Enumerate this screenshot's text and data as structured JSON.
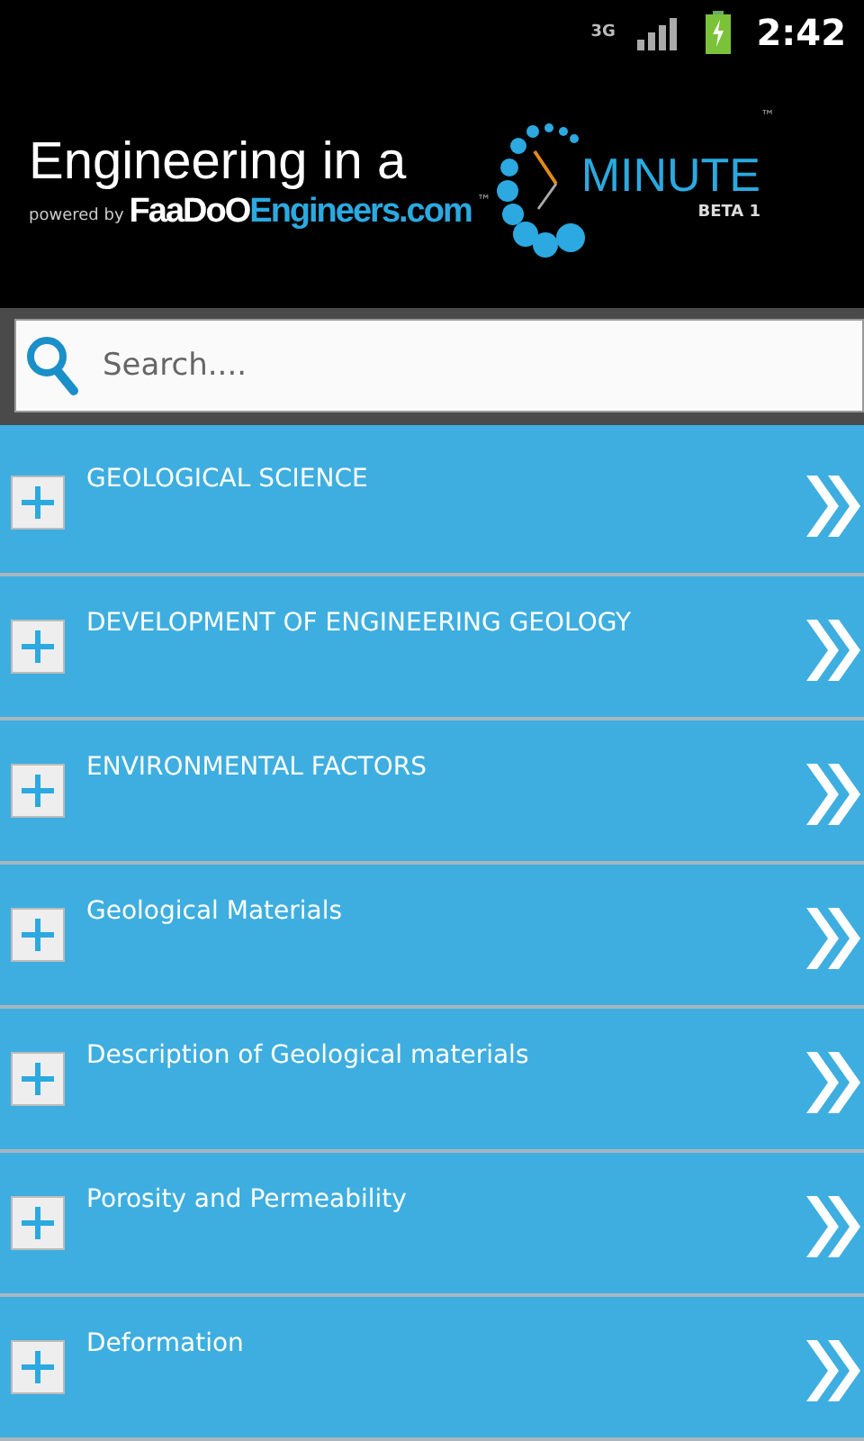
{
  "status_bar": {
    "network": "3G",
    "time": "2:42"
  },
  "banner": {
    "title": "Engineering in a",
    "minute": "MINUTE",
    "tm": "™",
    "beta": "BETA 1",
    "powered_by": "powered by",
    "brand_a": "FaaDoO",
    "brand_b": "Engineers.com",
    "brand_tm": "™"
  },
  "search": {
    "placeholder": "Search...."
  },
  "items": [
    {
      "label": "GEOLOGICAL SCIENCE"
    },
    {
      "label": "DEVELOPMENT OF ENGINEERING GEOLOGY"
    },
    {
      "label": "ENVIRONMENTAL FACTORS"
    },
    {
      "label": "Geological Materials"
    },
    {
      "label": "Description of Geological materials"
    },
    {
      "label": "Porosity and Permeability"
    },
    {
      "label": "Deformation"
    }
  ]
}
